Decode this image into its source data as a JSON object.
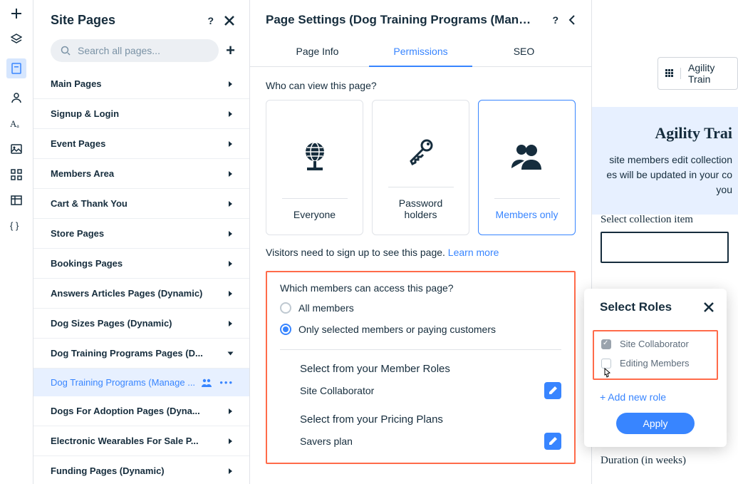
{
  "sitePages": {
    "title": "Site Pages",
    "search": {
      "placeholder": "Search all pages..."
    },
    "groups": [
      {
        "label": "Main Pages",
        "expanded": false
      },
      {
        "label": "Signup & Login",
        "expanded": false
      },
      {
        "label": "Event Pages",
        "expanded": false
      },
      {
        "label": "Members Area",
        "expanded": false
      },
      {
        "label": "Cart & Thank You",
        "expanded": false
      },
      {
        "label": "Store Pages",
        "expanded": false
      },
      {
        "label": "Bookings Pages",
        "expanded": false
      },
      {
        "label": "Answers Articles Pages (Dynamic)",
        "expanded": false
      },
      {
        "label": "Dog Sizes Pages (Dynamic)",
        "expanded": false
      },
      {
        "label": "Dog Training Programs Pages (D...",
        "expanded": true,
        "child": {
          "label": "Dog Training Programs (Manage ..."
        }
      },
      {
        "label": "Dogs For Adoption Pages (Dyna...",
        "expanded": false
      },
      {
        "label": "Electronic Wearables For Sale P...",
        "expanded": false
      },
      {
        "label": "Funding Pages (Dynamic)",
        "expanded": false
      }
    ]
  },
  "settings": {
    "title": "Page Settings (Dog Training Programs (Manage ...",
    "tabs": {
      "info": "Page Info",
      "permissions": "Permissions",
      "seo": "SEO",
      "active": "permissions"
    },
    "whoCanView": {
      "label": "Who can view this page?",
      "cards": {
        "everyone": "Everyone",
        "password": "Password holders",
        "members": "Members only"
      },
      "selected": "members"
    },
    "visitorsLine": {
      "pre": "Visitors need to sign up to see this page. ",
      "link": "Learn more"
    },
    "membersAccess": {
      "label": "Which members can access this page?",
      "options": {
        "all": "All members",
        "selected": "Only selected members or paying customers"
      },
      "chosen": "selected",
      "roles": {
        "heading": "Select from your Member Roles",
        "item": "Site Collaborator"
      },
      "plans": {
        "heading": "Select from your Pricing Plans",
        "item": "Savers plan"
      }
    }
  },
  "rolesPopover": {
    "title": "Select Roles",
    "roles": [
      {
        "label": "Site Collaborator",
        "checked": true
      },
      {
        "label": "Editing Members",
        "checked": false
      }
    ],
    "addNew": "+ Add new role",
    "apply": "Apply"
  },
  "background": {
    "chip": "Agility Train",
    "heroTitle": "Agility Trai",
    "heroBody1": "site members edit collection",
    "heroBody2": "es will be updated in your co",
    "heroBody3": "you",
    "selectItem": "Select collection item",
    "duration": "Duration (in weeks)"
  }
}
